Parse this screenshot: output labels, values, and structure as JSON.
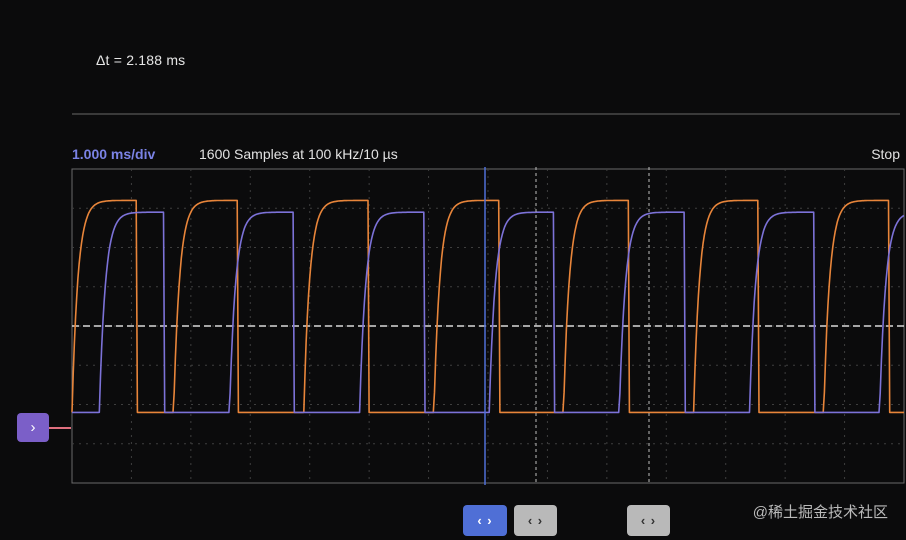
{
  "measurement": {
    "delta_t": "Δt = 2.188 ms"
  },
  "header": {
    "timebase": "1.000 ms/div",
    "samples": "1600 Samples at 100 kHz/10 µs",
    "status": "Stop"
  },
  "channel_marker": {
    "glyph": "›",
    "color": "#7b5fc8"
  },
  "cursor_buttons": [
    {
      "label": "‹ ›",
      "active": true
    },
    {
      "label": "‹ ›",
      "active": false
    },
    {
      "label": "‹ ›",
      "active": false
    }
  ],
  "watermark": "@稀土掘金技术社区",
  "colors": {
    "background": "#0b0b0c",
    "grid": "#3e3e3e",
    "channel_1": "#e8853a",
    "channel_2": "#7c72d8",
    "cursor_active": "#4f6fd6",
    "midline": "#d9d9d9"
  },
  "chart_data": {
    "type": "line",
    "title": "",
    "xlabel": "",
    "ylabel": "",
    "timebase_ms_per_div": 1.0,
    "x_unit": "ms",
    "xlim": [
      0,
      14
    ],
    "ylim": [
      -4,
      4
    ],
    "series": [
      {
        "color": "#e8853a",
        "shape": "square wave",
        "period_ms": 2.19,
        "high_start_ms": [
          0.0,
          1.71,
          3.9,
          6.09,
          8.27,
          10.46,
          12.65
        ],
        "high_duration_ms": 1.09,
        "high_level": 3.2,
        "low_level": -2.2
      },
      {
        "color": "#7c72d8",
        "shape": "square wave",
        "period_ms": 2.19,
        "high_start_ms": [
          0.46,
          2.65,
          4.84,
          7.02,
          9.21,
          11.4,
          13.59
        ],
        "high_duration_ms": 1.09,
        "high_level": 2.9,
        "low_level": -2.2
      }
    ],
    "grid": true,
    "legend": "none"
  }
}
